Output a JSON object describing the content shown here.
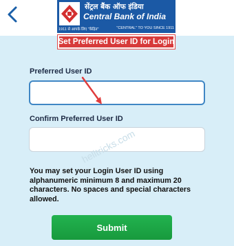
{
  "header": {
    "back_icon": "chevron-left-icon",
    "logo": {
      "hindi": "सेंट्रल बैंक ऑफ इंडिया",
      "english": "Central Bank of India",
      "sub_left": "1911 से आपके लिए \"केंद्रित\"",
      "sub_right": "\"CENTRAL\" TO YOU SINCE 1911"
    }
  },
  "page_title": "Set Preferred User ID for Login",
  "form": {
    "preferred_label": "Preferred User ID",
    "preferred_value": "",
    "confirm_label": "Confirm Preferred User ID",
    "confirm_value": "",
    "info": "You may set your Login User ID using alphanumeric minimum 8 and maximum 20 characters. No spaces and special characters allowed.",
    "submit_label": "Submit"
  },
  "watermark": "helltricks.com",
  "colors": {
    "background": "#d8eef8",
    "brand_blue": "#1b59a5",
    "title_red": "#d73a3a",
    "submit_green": "#1fa848",
    "annotation_red": "#e03c3c"
  }
}
